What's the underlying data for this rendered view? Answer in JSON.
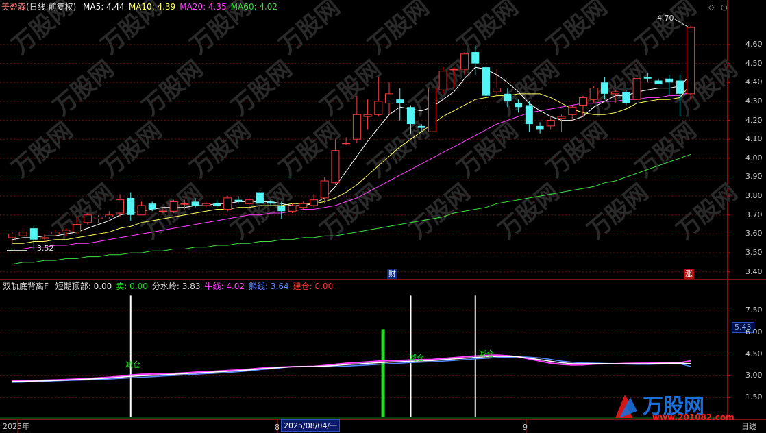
{
  "header": {
    "stock_name": "美盈森",
    "mode": "(日线 前复权)",
    "ma": [
      {
        "label": "MA5:",
        "value": "4.44",
        "color": "#ffffff"
      },
      {
        "label": "MA10:",
        "value": "4.39",
        "color": "#ffff66"
      },
      {
        "label": "MA20:",
        "value": "4.35",
        "color": "#ff44ff"
      },
      {
        "label": "MA60:",
        "value": "4.02",
        "color": "#44dd44"
      }
    ]
  },
  "indicator_header": {
    "name": "双轨底背离F",
    "items": [
      {
        "label": "短期顶部:",
        "value": "0.00",
        "color": "#dddddd"
      },
      {
        "label": "卖:",
        "value": "0.00",
        "color": "#22dd22"
      },
      {
        "label": "分水岭:",
        "value": "3.83",
        "color": "#dddddd"
      },
      {
        "label": "牛线:",
        "value": "4.02",
        "color": "#ff44ff"
      },
      {
        "label": "熊线:",
        "value": "3.64",
        "color": "#5b8cff"
      },
      {
        "label": "建仓:",
        "value": "0.00",
        "color": "#ff3333"
      }
    ]
  },
  "annotations": {
    "high_label": "4.70",
    "low_label": "3.52",
    "cai_tag": "财",
    "zhang_tag": "涨",
    "reduce_label": "减仓",
    "current_indicator_value": "5.43"
  },
  "axis": {
    "price_ticks": [
      "4.60",
      "4.50",
      "4.40",
      "4.30",
      "4.20",
      "4.10",
      "4.00",
      "3.90",
      "3.80",
      "3.70",
      "3.60",
      "3.50",
      "3.40"
    ],
    "indicator_ticks": [
      "7.50",
      "6.00",
      "4.50",
      "3.00",
      "1.50"
    ],
    "x_labels": [
      {
        "text": "2025年",
        "color": "#c8c8c8"
      },
      {
        "text": "8",
        "color": "#c8c8c8"
      },
      {
        "text": "2025/08/04/一",
        "color": "#ffffff"
      },
      {
        "text": "9",
        "color": "#c8c8c8"
      },
      {
        "text": "日线",
        "color": "#c8c8c8"
      }
    ]
  },
  "colors": {
    "up": "#ff3c3c",
    "down": "#54f4f4",
    "grid": "#6a1010",
    "divider": "#b01818",
    "ma5": "#ffffff",
    "ma10": "#ffff66",
    "ma20": "#ff44ff",
    "ma60": "#44dd44",
    "bull": "#ff44ff",
    "bear": "#5b8cff",
    "divide": "#ffffff",
    "buy_bar": "#22dd22"
  },
  "watermark": {
    "brand": "万股网",
    "domain": "www.201082.com"
  },
  "chart_data": [
    {
      "type": "candlestick",
      "title": "美盈森 (日线 前复权)",
      "ylim": [
        3.37,
        4.77
      ],
      "y_ticks": [
        3.4,
        3.5,
        3.6,
        3.7,
        3.8,
        3.9,
        4.0,
        4.1,
        4.2,
        4.3,
        4.4,
        4.5,
        4.6
      ],
      "candles": [
        {
          "o": 3.58,
          "h": 3.61,
          "l": 3.55,
          "c": 3.6
        },
        {
          "o": 3.59,
          "h": 3.63,
          "l": 3.57,
          "c": 3.61
        },
        {
          "o": 3.63,
          "h": 3.64,
          "l": 3.52,
          "c": 3.57
        },
        {
          "o": 3.58,
          "h": 3.6,
          "l": 3.56,
          "c": 3.58
        },
        {
          "o": 3.6,
          "h": 3.62,
          "l": 3.59,
          "c": 3.61
        },
        {
          "o": 3.61,
          "h": 3.63,
          "l": 3.59,
          "c": 3.62
        },
        {
          "o": 3.61,
          "h": 3.69,
          "l": 3.6,
          "c": 3.65
        },
        {
          "o": 3.66,
          "h": 3.71,
          "l": 3.65,
          "c": 3.7
        },
        {
          "o": 3.68,
          "h": 3.7,
          "l": 3.66,
          "c": 3.69
        },
        {
          "o": 3.69,
          "h": 3.72,
          "l": 3.68,
          "c": 3.7
        },
        {
          "o": 3.71,
          "h": 3.81,
          "l": 3.69,
          "c": 3.78
        },
        {
          "o": 3.79,
          "h": 3.82,
          "l": 3.67,
          "c": 3.7
        },
        {
          "o": 3.7,
          "h": 3.77,
          "l": 3.7,
          "c": 3.75
        },
        {
          "o": 3.76,
          "h": 3.77,
          "l": 3.72,
          "c": 3.73
        },
        {
          "o": 3.72,
          "h": 3.74,
          "l": 3.71,
          "c": 3.72
        },
        {
          "o": 3.72,
          "h": 3.78,
          "l": 3.71,
          "c": 3.77
        },
        {
          "o": 3.76,
          "h": 3.78,
          "l": 3.73,
          "c": 3.76
        },
        {
          "o": 3.77,
          "h": 3.79,
          "l": 3.74,
          "c": 3.75
        },
        {
          "o": 3.75,
          "h": 3.77,
          "l": 3.74,
          "c": 3.76
        },
        {
          "o": 3.76,
          "h": 3.78,
          "l": 3.74,
          "c": 3.75
        },
        {
          "o": 3.73,
          "h": 3.8,
          "l": 3.72,
          "c": 3.79
        },
        {
          "o": 3.78,
          "h": 3.8,
          "l": 3.76,
          "c": 3.77
        },
        {
          "o": 3.76,
          "h": 3.79,
          "l": 3.74,
          "c": 3.78
        },
        {
          "o": 3.82,
          "h": 3.83,
          "l": 3.75,
          "c": 3.76
        },
        {
          "o": 3.77,
          "h": 3.78,
          "l": 3.75,
          "c": 3.76
        },
        {
          "o": 3.75,
          "h": 3.77,
          "l": 3.68,
          "c": 3.72
        },
        {
          "o": 3.72,
          "h": 3.76,
          "l": 3.71,
          "c": 3.75
        },
        {
          "o": 3.74,
          "h": 3.77,
          "l": 3.73,
          "c": 3.76
        },
        {
          "o": 3.75,
          "h": 3.81,
          "l": 3.74,
          "c": 3.78
        },
        {
          "o": 3.79,
          "h": 3.9,
          "l": 3.76,
          "c": 3.88
        },
        {
          "o": 3.87,
          "h": 4.1,
          "l": 3.86,
          "c": 4.04
        },
        {
          "o": 4.08,
          "h": 4.11,
          "l": 4.07,
          "c": 4.08
        },
        {
          "o": 4.1,
          "h": 4.33,
          "l": 4.08,
          "c": 4.23
        },
        {
          "o": 4.22,
          "h": 4.31,
          "l": 4.15,
          "c": 4.23
        },
        {
          "o": 4.23,
          "h": 4.43,
          "l": 4.22,
          "c": 4.3
        },
        {
          "o": 4.29,
          "h": 4.4,
          "l": 4.23,
          "c": 4.34
        },
        {
          "o": 4.31,
          "h": 4.37,
          "l": 4.2,
          "c": 4.29
        },
        {
          "o": 4.27,
          "h": 4.28,
          "l": 4.13,
          "c": 4.18
        },
        {
          "o": 4.17,
          "h": 4.18,
          "l": 4.14,
          "c": 4.16
        },
        {
          "o": 4.14,
          "h": 4.37,
          "l": 4.14,
          "c": 4.37
        },
        {
          "o": 4.36,
          "h": 4.48,
          "l": 4.34,
          "c": 4.46
        },
        {
          "o": 4.47,
          "h": 4.48,
          "l": 4.37,
          "c": 4.47
        },
        {
          "o": 4.47,
          "h": 4.56,
          "l": 4.44,
          "c": 4.55
        },
        {
          "o": 4.56,
          "h": 4.6,
          "l": 4.44,
          "c": 4.5
        },
        {
          "o": 4.48,
          "h": 4.49,
          "l": 4.28,
          "c": 4.33
        },
        {
          "o": 4.35,
          "h": 4.47,
          "l": 4.33,
          "c": 4.37
        },
        {
          "o": 4.34,
          "h": 4.37,
          "l": 4.27,
          "c": 4.3
        },
        {
          "o": 4.29,
          "h": 4.31,
          "l": 4.24,
          "c": 4.27
        },
        {
          "o": 4.28,
          "h": 4.3,
          "l": 4.14,
          "c": 4.18
        },
        {
          "o": 4.17,
          "h": 4.19,
          "l": 4.13,
          "c": 4.15
        },
        {
          "o": 4.17,
          "h": 4.22,
          "l": 4.15,
          "c": 4.2
        },
        {
          "o": 4.21,
          "h": 4.23,
          "l": 4.14,
          "c": 4.22
        },
        {
          "o": 4.23,
          "h": 4.28,
          "l": 4.2,
          "c": 4.27
        },
        {
          "o": 4.28,
          "h": 4.33,
          "l": 4.22,
          "c": 4.32
        },
        {
          "o": 4.31,
          "h": 4.38,
          "l": 4.29,
          "c": 4.37
        },
        {
          "o": 4.4,
          "h": 4.43,
          "l": 4.31,
          "c": 4.34
        },
        {
          "o": 4.34,
          "h": 4.36,
          "l": 4.29,
          "c": 4.35
        },
        {
          "o": 4.35,
          "h": 4.36,
          "l": 4.28,
          "c": 4.29
        },
        {
          "o": 4.31,
          "h": 4.5,
          "l": 4.3,
          "c": 4.42
        },
        {
          "o": 4.43,
          "h": 4.45,
          "l": 4.4,
          "c": 4.42
        },
        {
          "o": 4.41,
          "h": 4.42,
          "l": 4.39,
          "c": 4.39
        },
        {
          "o": 4.42,
          "h": 4.44,
          "l": 4.33,
          "c": 4.4
        },
        {
          "o": 4.41,
          "h": 4.44,
          "l": 4.22,
          "c": 4.34
        },
        {
          "o": 4.34,
          "h": 4.7,
          "l": 4.31,
          "c": 4.69
        }
      ],
      "ma5": [
        3.57,
        3.58,
        3.58,
        3.59,
        3.59,
        3.6,
        3.61,
        3.63,
        3.65,
        3.67,
        3.7,
        3.71,
        3.72,
        3.73,
        3.74,
        3.74,
        3.74,
        3.75,
        3.75,
        3.76,
        3.76,
        3.77,
        3.77,
        3.77,
        3.77,
        3.76,
        3.75,
        3.75,
        3.76,
        3.79,
        3.85,
        3.93,
        4.01,
        4.09,
        4.16,
        4.23,
        4.27,
        4.26,
        4.25,
        4.27,
        4.31,
        4.35,
        4.42,
        4.48,
        4.47,
        4.44,
        4.4,
        4.35,
        4.29,
        4.25,
        4.22,
        4.2,
        4.2,
        4.22,
        4.27,
        4.3,
        4.33,
        4.33,
        4.35,
        4.36,
        4.37,
        4.37,
        4.38,
        4.44
      ],
      "ma10": [
        3.55,
        3.55,
        3.56,
        3.56,
        3.57,
        3.57,
        3.58,
        3.59,
        3.6,
        3.61,
        3.63,
        3.64,
        3.66,
        3.67,
        3.68,
        3.69,
        3.7,
        3.71,
        3.72,
        3.73,
        3.73,
        3.74,
        3.74,
        3.75,
        3.75,
        3.75,
        3.76,
        3.76,
        3.76,
        3.77,
        3.79,
        3.82,
        3.86,
        3.91,
        3.96,
        4.01,
        4.06,
        4.1,
        4.14,
        4.18,
        4.22,
        4.25,
        4.28,
        4.31,
        4.32,
        4.33,
        4.33,
        4.34,
        4.34,
        4.34,
        4.32,
        4.29,
        4.26,
        4.24,
        4.23,
        4.23,
        4.24,
        4.26,
        4.29,
        4.3,
        4.31,
        4.31,
        4.32,
        4.39
      ],
      "ma20": [
        3.52,
        3.52,
        3.53,
        3.53,
        3.54,
        3.54,
        3.55,
        3.55,
        3.56,
        3.57,
        3.58,
        3.59,
        3.6,
        3.61,
        3.62,
        3.63,
        3.64,
        3.65,
        3.66,
        3.67,
        3.68,
        3.69,
        3.7,
        3.7,
        3.71,
        3.71,
        3.72,
        3.73,
        3.73,
        3.74,
        3.75,
        3.77,
        3.79,
        3.82,
        3.85,
        3.88,
        3.91,
        3.94,
        3.97,
        4.0,
        4.03,
        4.06,
        4.09,
        4.12,
        4.15,
        4.18,
        4.2,
        4.22,
        4.24,
        4.25,
        4.26,
        4.27,
        4.28,
        4.29,
        4.29,
        4.3,
        4.3,
        4.31,
        4.31,
        4.32,
        4.32,
        4.33,
        4.33,
        4.35
      ],
      "ma60": [
        3.44,
        3.45,
        3.45,
        3.46,
        3.46,
        3.47,
        3.47,
        3.48,
        3.48,
        3.49,
        3.49,
        3.5,
        3.5,
        3.51,
        3.51,
        3.52,
        3.52,
        3.53,
        3.53,
        3.54,
        3.54,
        3.55,
        3.55,
        3.56,
        3.56,
        3.57,
        3.57,
        3.58,
        3.58,
        3.59,
        3.59,
        3.6,
        3.61,
        3.62,
        3.63,
        3.64,
        3.65,
        3.66,
        3.67,
        3.68,
        3.69,
        3.71,
        3.72,
        3.73,
        3.74,
        3.76,
        3.77,
        3.78,
        3.79,
        3.8,
        3.81,
        3.82,
        3.83,
        3.84,
        3.85,
        3.87,
        3.88,
        3.9,
        3.92,
        3.94,
        3.96,
        3.98,
        4.0,
        4.02
      ]
    },
    {
      "type": "line",
      "title": "双轨底背离F",
      "ylim": [
        0.2,
        8.8
      ],
      "y_ticks": [
        1.5,
        3.0,
        4.5,
        6.0,
        7.5
      ],
      "bull_line": [
        2.65,
        2.66,
        2.68,
        2.7,
        2.72,
        2.75,
        2.78,
        2.82,
        2.86,
        2.9,
        2.96,
        3.05,
        3.1,
        3.12,
        3.14,
        3.16,
        3.2,
        3.24,
        3.28,
        3.32,
        3.36,
        3.4,
        3.45,
        3.52,
        3.56,
        3.6,
        3.62,
        3.63,
        3.65,
        3.7,
        3.78,
        3.85,
        3.9,
        3.95,
        4.0,
        4.03,
        4.05,
        4.08,
        4.1,
        4.12,
        4.18,
        4.24,
        4.3,
        4.36,
        4.4,
        4.42,
        4.38,
        4.3,
        4.15,
        4.0,
        3.86,
        3.78,
        3.74,
        3.75,
        3.8,
        3.82,
        3.82,
        3.84,
        3.85,
        3.86,
        3.88,
        3.88,
        3.9,
        4.02
      ],
      "bear_line": [
        2.55,
        2.57,
        2.6,
        2.62,
        2.65,
        2.68,
        2.7,
        2.72,
        2.75,
        2.78,
        2.82,
        2.86,
        2.9,
        2.94,
        2.98,
        3.02,
        3.06,
        3.1,
        3.14,
        3.18,
        3.22,
        3.28,
        3.34,
        3.42,
        3.48,
        3.55,
        3.62,
        3.64,
        3.62,
        3.61,
        3.62,
        3.66,
        3.7,
        3.74,
        3.78,
        3.82,
        3.86,
        3.9,
        3.93,
        3.96,
        4.0,
        4.05,
        4.1,
        4.16,
        4.2,
        4.24,
        4.28,
        4.3,
        4.28,
        4.22,
        4.12,
        4.0,
        3.92,
        3.88,
        3.86,
        3.84,
        3.82,
        3.8,
        3.78,
        3.78,
        3.8,
        3.82,
        3.82,
        3.64
      ],
      "divide_line": [
        2.6,
        2.62,
        2.64,
        2.66,
        2.68,
        2.71,
        2.74,
        2.77,
        2.81,
        2.85,
        2.9,
        2.96,
        3.0,
        3.03,
        3.06,
        3.1,
        3.14,
        3.18,
        3.22,
        3.26,
        3.3,
        3.35,
        3.4,
        3.47,
        3.52,
        3.57,
        3.62,
        3.63,
        3.63,
        3.66,
        3.7,
        3.76,
        3.8,
        3.85,
        3.89,
        3.93,
        3.96,
        3.99,
        4.02,
        4.04,
        4.1,
        4.15,
        4.2,
        4.26,
        4.3,
        4.33,
        4.33,
        4.3,
        4.2,
        4.1,
        3.99,
        3.89,
        3.83,
        3.82,
        3.83,
        3.83,
        3.82,
        3.82,
        3.82,
        3.82,
        3.84,
        3.85,
        3.86,
        3.83
      ],
      "white_signal_bars": [
        11,
        37,
        43
      ],
      "buy_bar": {
        "index": 35,
        "value": 6.2
      },
      "reduce_labels_at": [
        11,
        37,
        43
      ]
    }
  ]
}
